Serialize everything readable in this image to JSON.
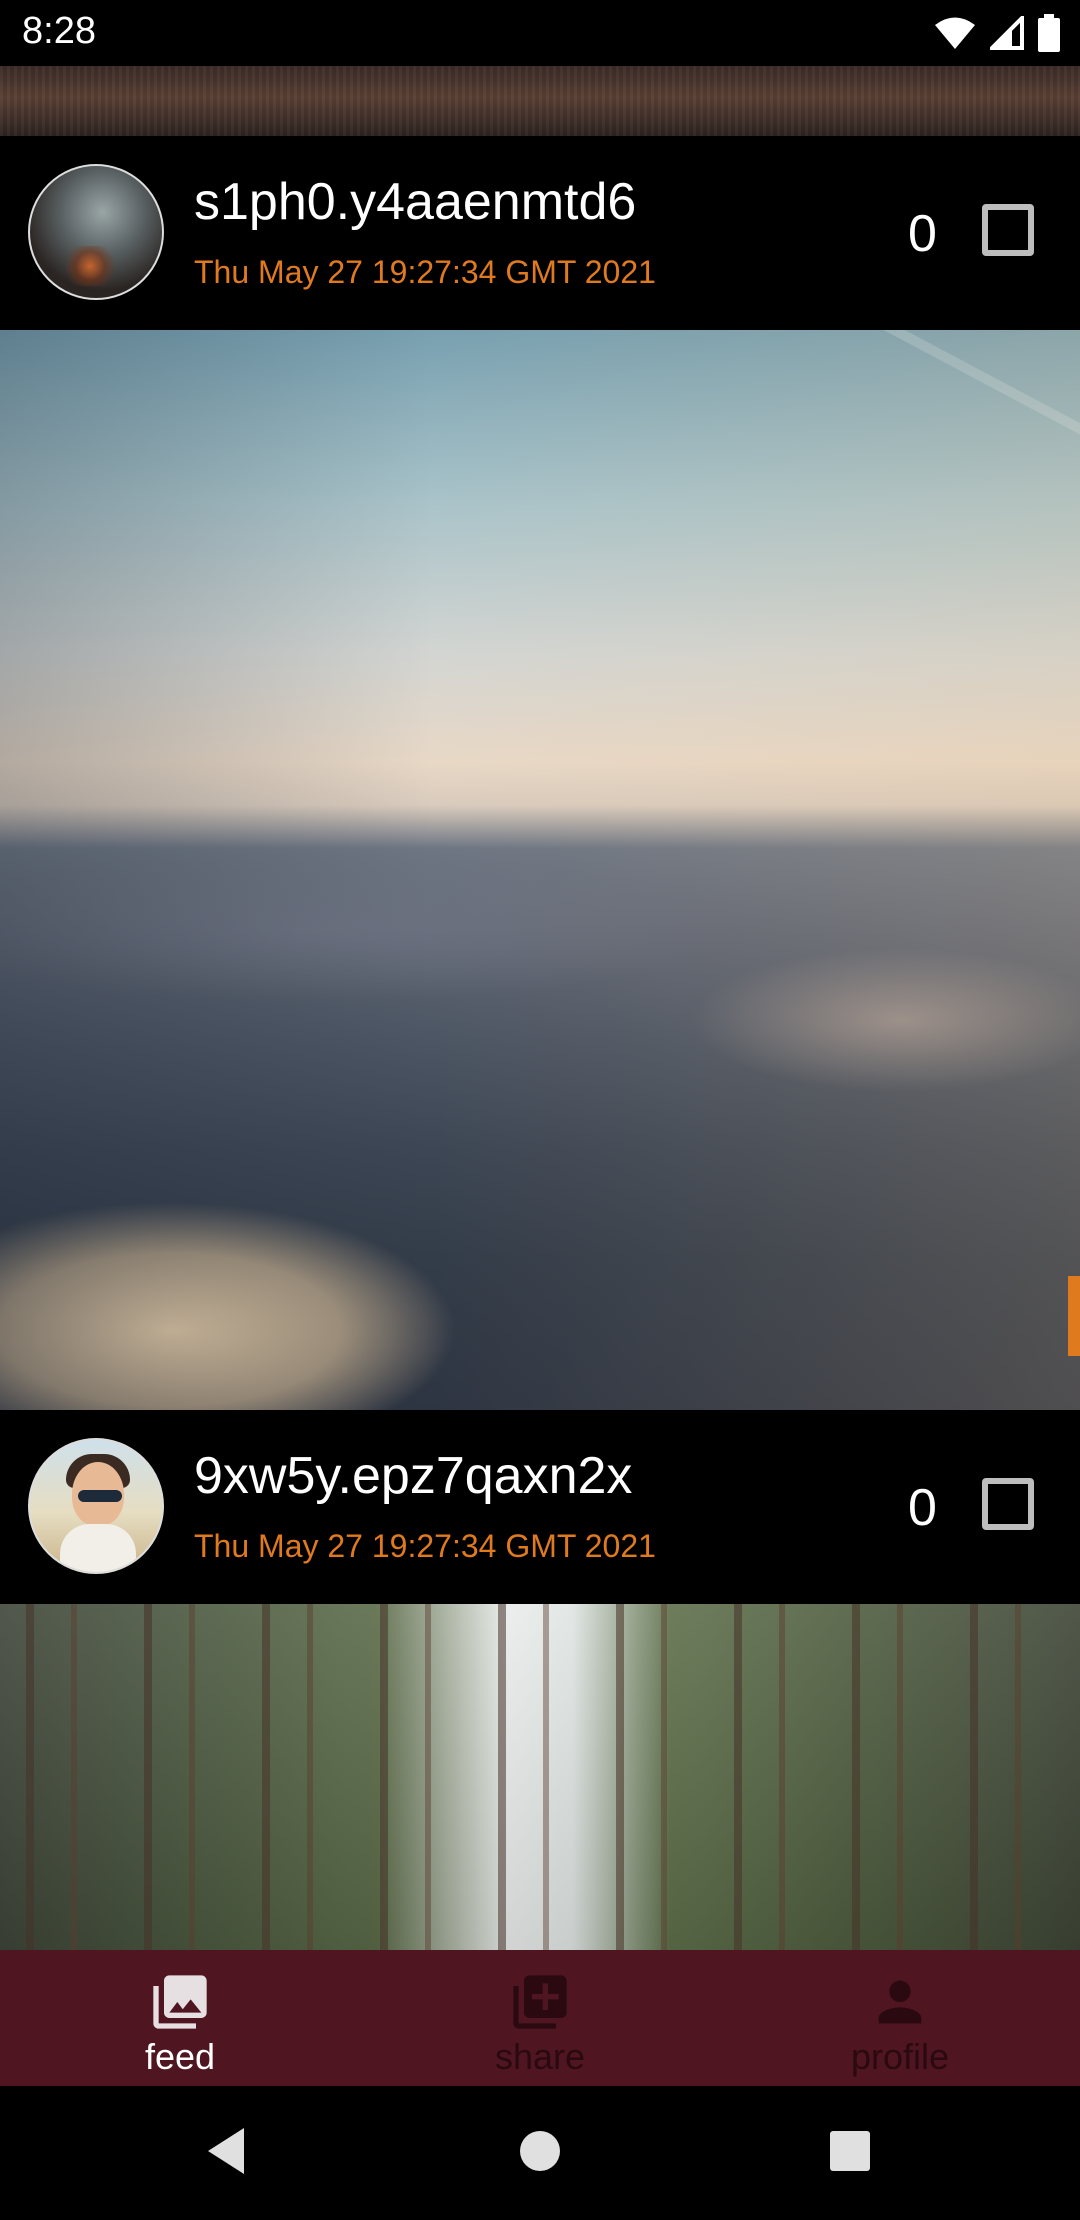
{
  "status_bar": {
    "time": "8:28"
  },
  "feed": {
    "posts": [
      {
        "username": "s1ph0.y4aaenmtd6",
        "timestamp": "Thu May 27 19:27:34 GMT 2021",
        "likes": "0",
        "liked": false,
        "photo": "clouds"
      },
      {
        "username": "9xw5y.epz7qaxn2x",
        "timestamp": "Thu May 27 19:27:34 GMT 2021",
        "likes": "0",
        "liked": false,
        "photo": "forest"
      }
    ]
  },
  "bottom_nav": {
    "items": [
      {
        "label": "feed",
        "icon": "photo-library-icon",
        "active": true
      },
      {
        "label": "share",
        "icon": "add-photo-icon",
        "active": false
      },
      {
        "label": "profile",
        "icon": "person-icon",
        "active": false
      }
    ]
  },
  "colors": {
    "accent": "#e07a1f",
    "nav_background": "#4f1520",
    "inactive_nav": "#2a0a10"
  }
}
